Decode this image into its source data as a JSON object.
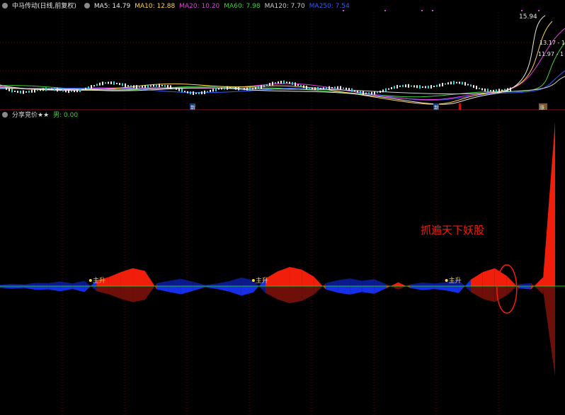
{
  "top_panel": {
    "stock_title": "中马传动(日线,前复权)",
    "ma_labels": [
      {
        "text": "MA5: 14.79",
        "color": "#e8e8e8"
      },
      {
        "text": "MA10: 12.88",
        "color": "#ffd24a"
      },
      {
        "text": "MA20: 10.20",
        "color": "#e040e0"
      },
      {
        "text": "MA60: 7.98",
        "color": "#3cd23c"
      },
      {
        "text": "MA120: 7.70",
        "color": "#cfcfcf"
      },
      {
        "text": "MA250: 7.54",
        "color": "#2f5bff"
      }
    ],
    "price_labels": [
      "15.94",
      "13.17 - 1",
      "11.97 - 1"
    ],
    "markers": [
      "新",
      "新",
      "涨"
    ]
  },
  "sub_panel": {
    "indicator_title": "分享竞价★★",
    "indicator_value": "男: 0.00",
    "colors": {
      "red": "#f01e0a",
      "blue": "#1530e6",
      "dark_red": "#6e0f0a",
      "dark_blue": "#0a1a8c",
      "zero_line": "#1fbf1f"
    }
  },
  "annotations": {
    "rise_label": "主升",
    "headline": "抓遍天下妖股"
  },
  "chart_data": {
    "type": "area",
    "x": [
      0,
      4,
      8,
      12,
      16,
      20,
      24,
      28,
      32,
      36,
      40,
      44,
      48,
      52,
      56,
      60,
      64,
      68,
      72,
      76,
      80,
      84,
      88,
      92,
      96,
      100,
      104,
      108,
      112,
      116,
      120,
      124,
      128,
      132,
      136,
      140,
      144,
      148,
      152,
      156,
      160,
      164,
      168,
      172,
      176,
      180,
      184
    ],
    "series": [
      {
        "values": [
          -0.4,
          -0.7,
          -0.5,
          -1.0,
          -0.9,
          -1.4,
          -0.8,
          -1.6,
          0.9,
          1.4,
          2.2,
          2.8,
          2.4,
          -0.9,
          -1.6,
          -2.2,
          -1.3,
          -0.3,
          -0.8,
          -1.5,
          -2.6,
          -1.7,
          1.2,
          2.3,
          3.0,
          2.6,
          1.5,
          -0.9,
          -1.8,
          -2.3,
          -1.6,
          -2.1,
          -0.6,
          0.6,
          -0.5,
          -1.1,
          -0.8,
          -1.2,
          -1.9,
          1.0,
          2.2,
          2.8,
          1.6,
          -0.6,
          -0.9,
          1.4,
          33.0
        ]
      }
    ],
    "rise_marks_at_x": [
      30,
      84,
      148
    ],
    "highlight_at_x": 168,
    "ylim": [
      -9,
      33
    ]
  }
}
